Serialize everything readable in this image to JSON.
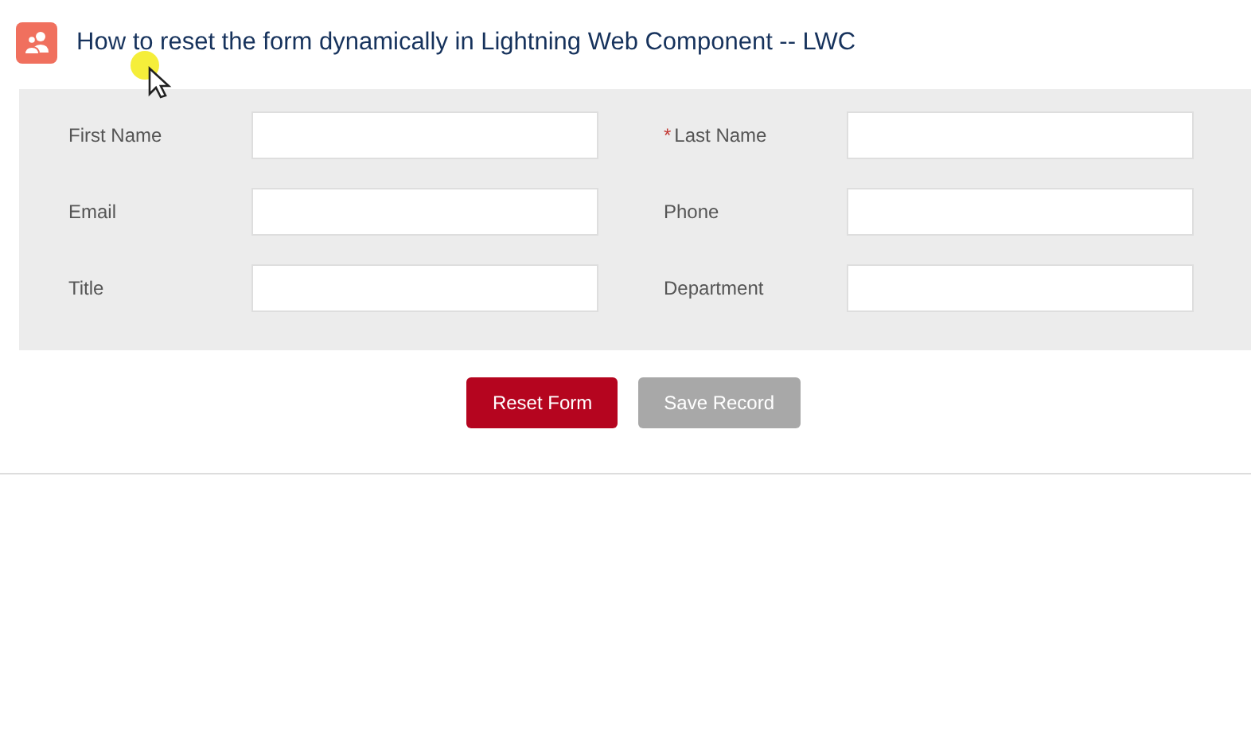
{
  "header": {
    "title": "How to reset the form dynamically in Lightning Web Component -- LWC"
  },
  "fields": [
    {
      "label": "First Name",
      "required": false
    },
    {
      "label": "Last Name",
      "required": true
    },
    {
      "label": "Email",
      "required": false
    },
    {
      "label": "Phone",
      "required": false
    },
    {
      "label": "Title",
      "required": false
    },
    {
      "label": "Department",
      "required": false
    }
  ],
  "required_mark": "*",
  "buttons": [
    {
      "label": "Reset Form",
      "disabled": false
    },
    {
      "label": "Save Record",
      "disabled": true
    }
  ]
}
